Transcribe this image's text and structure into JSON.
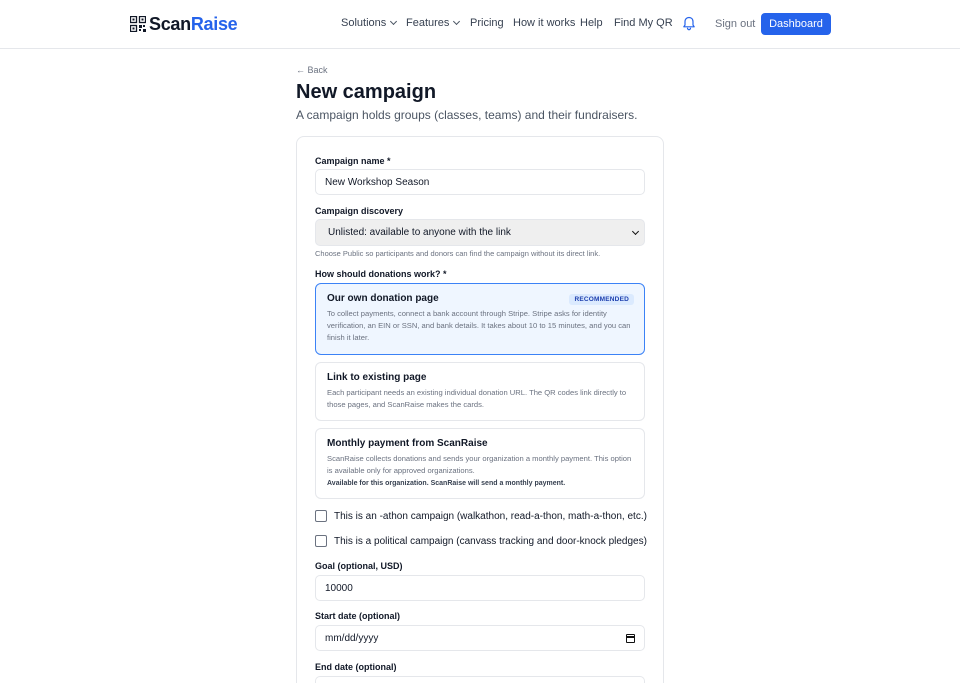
{
  "header": {
    "logo_scan": "Scan",
    "logo_raise": "Raise",
    "nav": {
      "solutions": "Solutions",
      "features": "Features",
      "pricing": "Pricing",
      "how_it_works": "How it works",
      "help": "Help",
      "find_my_qr": "Find My QR"
    },
    "sign_out": "Sign out",
    "dashboard": "Dashboard",
    "accent_color": "#2563eb"
  },
  "page": {
    "back": "← Back",
    "title": "New campaign",
    "subtitle": "A campaign holds groups (classes, teams) and their fundraisers."
  },
  "form": {
    "campaign_name_label": "Campaign name *",
    "campaign_name_value": "New Workshop Season",
    "discovery_label": "Campaign discovery",
    "discovery_value": "Unlisted: available to anyone with the link",
    "discovery_help": "Choose Public so participants and donors can find the campaign without its direct link.",
    "donations_label": "How should donations work? *",
    "options": [
      {
        "title": "Our own donation page",
        "badge": "RECOMMENDED",
        "desc": "To collect payments, connect a bank account through Stripe. Stripe asks for identity verification, an EIN or SSN, and bank details. It takes about 10 to 15 minutes, and you can finish it later."
      },
      {
        "title": "Link to existing page",
        "desc": "Each participant needs an existing individual donation URL. The QR codes link directly to those pages, and ScanRaise makes the cards."
      },
      {
        "title": "Monthly payment from ScanRaise",
        "desc": "ScanRaise collects donations and sends your organization a monthly payment. This option is available only for approved organizations.",
        "note": "Available for this organization. ScanRaise will send a monthly payment."
      }
    ],
    "athon_label": "This is an -athon campaign (walkathon, read-a-thon, math-a-thon, etc.)",
    "political_label": "This is a political campaign (canvass tracking and door-knock pledges)",
    "goal_label": "Goal (optional, USD)",
    "goal_value": "10000",
    "start_label": "Start date (optional)",
    "start_value": "mm/dd/yyyy",
    "end_label": "End date (optional)"
  }
}
